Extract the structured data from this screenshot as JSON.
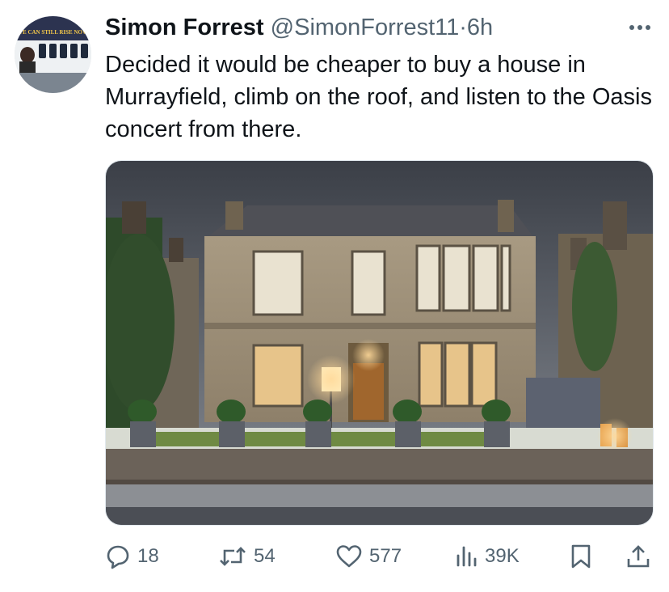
{
  "tweet": {
    "author_name": "Simon Forrest",
    "handle": "@SimonForrest11",
    "separator": "·",
    "time": "6h",
    "text": "Decided it would be cheaper to buy a house in Murrayfield, climb on the roof, and listen to the Oasis concert from there.",
    "avatar_banner_text": "WE CAN STILL RISE NOW"
  },
  "actions": {
    "replies": "18",
    "reposts": "54",
    "likes": "577",
    "views": "39K"
  },
  "icons": {
    "more": "more-icon",
    "reply": "reply-icon",
    "repost": "repost-icon",
    "like": "heart-icon",
    "views": "views-icon",
    "bookmark": "bookmark-icon",
    "share": "share-icon"
  },
  "colors": {
    "text": "#0f1419",
    "secondary": "#536471"
  }
}
